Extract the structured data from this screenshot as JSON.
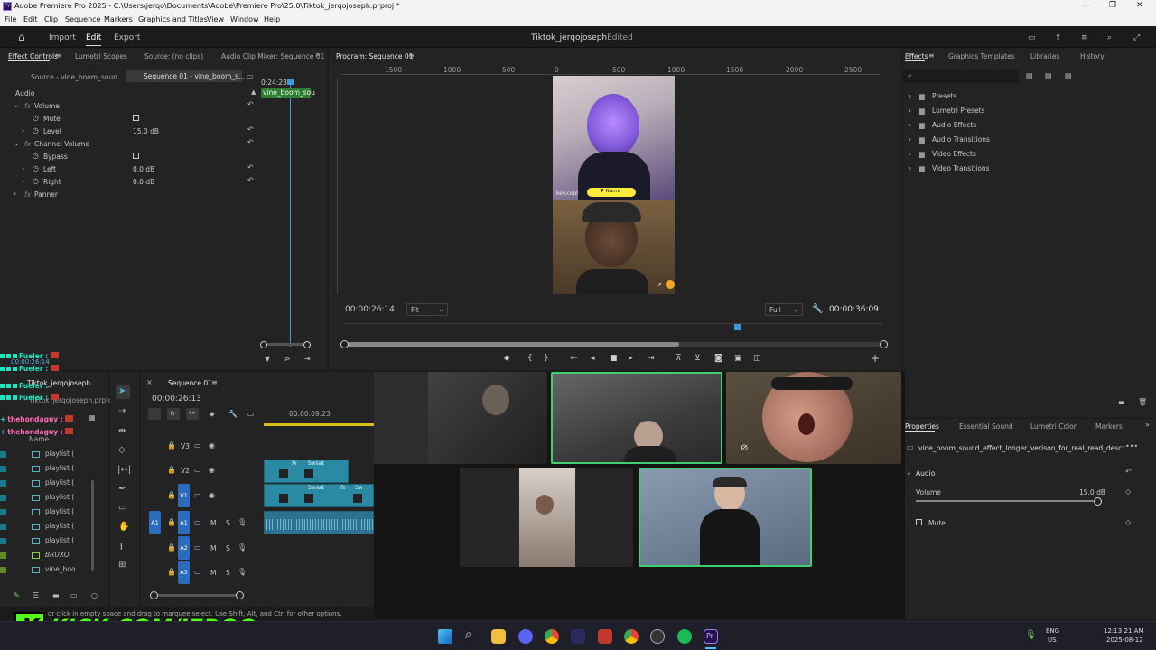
{
  "window": {
    "title": "Adobe Premiere Pro 2025 - C:\\Users\\jerqo\\Documents\\Adobe\\Premiere Pro\\25.0\\Tiktok_jerqojoseph.prproj *",
    "menu": [
      "File",
      "Edit",
      "Clip",
      "Sequence",
      "Markers",
      "Graphics and Titles",
      "View",
      "Window",
      "Help"
    ]
  },
  "workspace": {
    "modes": [
      "Import",
      "Edit",
      "Export"
    ],
    "active_mode": "Edit",
    "project_title": "Tiktok_jerqojoseph",
    "project_state": "- Edited"
  },
  "effect_controls": {
    "tabs": [
      "Effect Controls",
      "Lumetri Scopes",
      "Source: (no clips)",
      "Audio Clip Mixer: Sequence 01"
    ],
    "source_label": "Source - vine_boom_soun...",
    "sequence_label": "Sequence 01 - vine_boom_s...",
    "timecode": "0:24:23",
    "clip_name": "vine_boom_sou",
    "section": "Audio",
    "rows": [
      {
        "label": "Volume",
        "value": ""
      },
      {
        "label": "Mute",
        "value": ""
      },
      {
        "label": "Level",
        "value": "15.0 dB"
      },
      {
        "label": "Channel Volume",
        "value": ""
      },
      {
        "label": "Bypass",
        "value": ""
      },
      {
        "label": "Left",
        "value": "0.0 dB"
      },
      {
        "label": "Right",
        "value": "0.0 dB"
      },
      {
        "label": "Panner",
        "value": ""
      }
    ]
  },
  "program_monitor": {
    "tab": "Program: Sequence 01",
    "ruler_labels": [
      "1500",
      "1000",
      "500",
      "0",
      "500",
      "1000",
      "1500",
      "2000",
      "2500"
    ],
    "timecode": "00:00:26:14",
    "fit": "Fit",
    "quality": "Full",
    "duration": "00:00:36:09",
    "overlay_user": "key.cool",
    "overlay_pill": "♥ Name",
    "progress": 0.62
  },
  "effects_panel": {
    "tabs": [
      "Effects",
      "Graphics Templates",
      "Libraries",
      "History"
    ],
    "items": [
      "Presets",
      "Lumetri Presets",
      "Audio Effects",
      "Audio Transitions",
      "Video Effects",
      "Video Transitions"
    ]
  },
  "properties_panel": {
    "tabs": [
      "Properties",
      "Essential Sound",
      "Lumetri Color",
      "Markers"
    ],
    "clip": "vine_boom_sound_effect_longer_verison_for_real_read_descr...",
    "section": "Audio",
    "volume_label": "Volume",
    "volume_value": "15.0 dB",
    "mute_label": "Mute"
  },
  "project_panel": {
    "title": "Tiktok_jerqojoseph",
    "file": "Tiktok_jerqojoseph.prproj",
    "name_header": "Name",
    "items": [
      "playlist (",
      "playlist (",
      "playlist (",
      "playlist (",
      "playlist (",
      "playlist (",
      "playlist (",
      "BRUXO",
      "vine_boo"
    ]
  },
  "chat": {
    "lines": [
      {
        "user": "Fueler :",
        "color": "#19e6c0"
      },
      {
        "user": "Fueler :",
        "color": "#19e6c0"
      },
      {
        "user": "Fueler :",
        "color": "#19e6c0"
      },
      {
        "user": "Fueler :",
        "color": "#19e6c0"
      },
      {
        "user": "thehondaguy :",
        "color": "#ff6bb5"
      },
      {
        "user": "thehondaguy :",
        "color": "#ff6bb5"
      }
    ],
    "timestamp": "00:00:26:14"
  },
  "timeline": {
    "tab": "Sequence 01",
    "timecode": "00:00:26:13",
    "ruler_time": "00:00:09:23",
    "tracks": [
      "V3",
      "V2",
      "V1",
      "A1",
      "A2",
      "A3"
    ],
    "clip_labels": [
      "Swsat",
      "fx",
      "Swsat",
      "fx",
      "Sw"
    ]
  },
  "status_bar": "ct, or click in empty space and drag to marquee select. Use Shift, Alt, and Ctrl for other options.",
  "overlay_brand": "KICK.COM/JERQO",
  "taskbar": {
    "lang_top": "ENG",
    "lang_bottom": "US",
    "time": "12:13:21 AM",
    "date": "2025-08-12"
  },
  "colors": {
    "accent_blue": "#2b6cbf",
    "kick_green": "#53fc18",
    "cam_border_green": "#3ecf6e",
    "chat_green": "#19e6c0",
    "chat_pink": "#ff6bb5"
  }
}
